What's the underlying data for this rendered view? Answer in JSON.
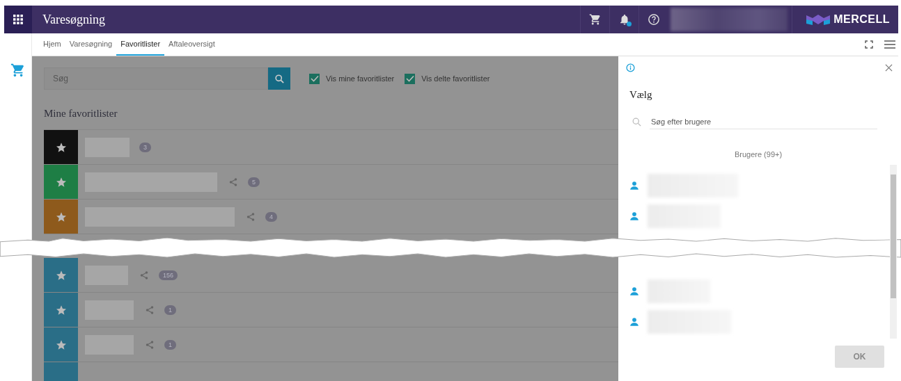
{
  "header": {
    "title": "Varesøgning",
    "notification_dot": true,
    "logo_text": "MERCELL"
  },
  "tabs": [
    {
      "label": "Hjem",
      "selected": false
    },
    {
      "label": "Varesøgning",
      "selected": false
    },
    {
      "label": "Favoritlister",
      "selected": true
    },
    {
      "label": "Aftaleoversigt",
      "selected": false
    }
  ],
  "search": {
    "placeholder": "Søg"
  },
  "filters": [
    {
      "label": "Vis mine favoritlister",
      "checked": true
    },
    {
      "label": "Vis delte favoritlister",
      "checked": true
    }
  ],
  "section_title": "Mine favoritlister",
  "lists_before_tear": [
    {
      "color": "#111111",
      "shared": false,
      "count": "3"
    },
    {
      "color": "#1e7e45",
      "shared": true,
      "count": "5"
    },
    {
      "color": "#8e5a1c",
      "shared": true,
      "count": "4"
    }
  ],
  "lists_after_tear": [
    {
      "color": "#2a6e87",
      "shared": true,
      "count": "156"
    },
    {
      "color": "#2a6e87",
      "shared": true,
      "count": "1"
    },
    {
      "color": "#2a6e87",
      "shared": true,
      "count": "1"
    },
    {
      "color": "#2a6e87",
      "shared": false,
      "partial": true
    }
  ],
  "panel": {
    "title": "Vælg",
    "search_placeholder": "Søg efter brugere",
    "users_heading": "Brugere (99+)",
    "ok_button": {
      "label": "OK",
      "disabled": true
    }
  }
}
